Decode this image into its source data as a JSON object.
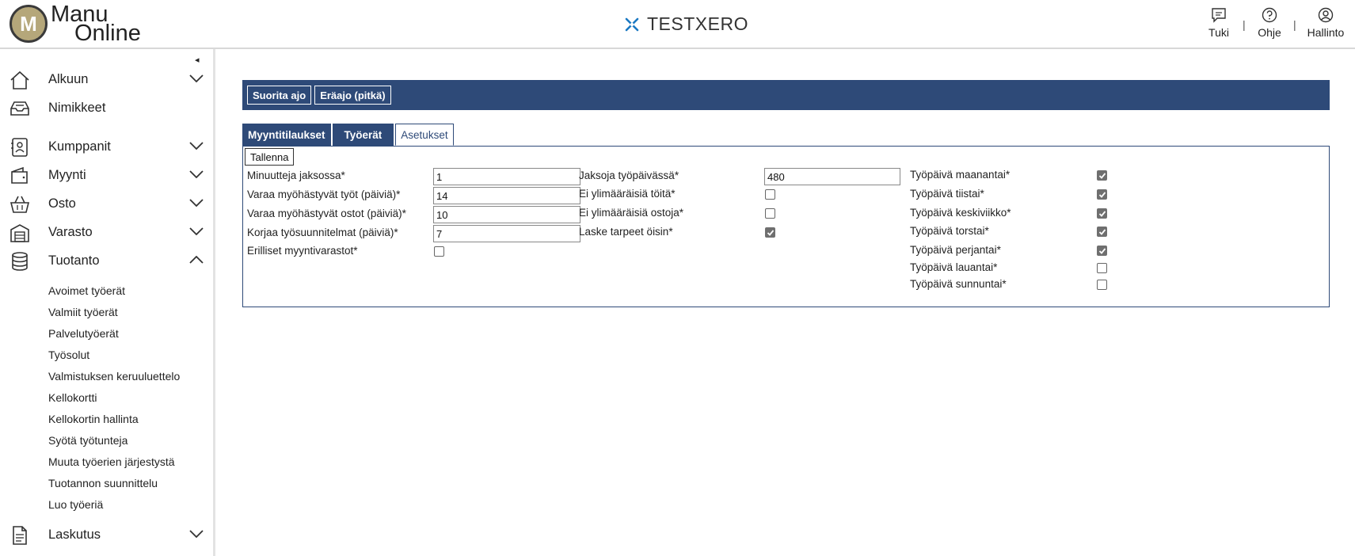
{
  "header": {
    "logo_mark": "M",
    "logo_line1": "Manu",
    "logo_line2": "Online",
    "brand": "TESTXERO",
    "actions": [
      {
        "label": "Tuki",
        "icon": "chat-icon"
      },
      {
        "label": "Ohje",
        "icon": "help-icon"
      },
      {
        "label": "Hallinto",
        "icon": "user-icon"
      }
    ],
    "separator": "|"
  },
  "sidebar": {
    "collapse_icon": "◂",
    "items": [
      {
        "label": "Alkuun",
        "icon": "home-icon",
        "expandable": true,
        "expanded": false
      },
      {
        "label": "Nimikkeet",
        "icon": "inbox-icon",
        "expandable": false
      },
      {
        "label": "Kumppanit",
        "icon": "contacts-icon",
        "expandable": true,
        "expanded": false
      },
      {
        "label": "Myynti",
        "icon": "wallet-icon",
        "expandable": true,
        "expanded": false
      },
      {
        "label": "Osto",
        "icon": "basket-icon",
        "expandable": true,
        "expanded": false
      },
      {
        "label": "Varasto",
        "icon": "warehouse-icon",
        "expandable": true,
        "expanded": false
      },
      {
        "label": "Tuotanto",
        "icon": "database-icon",
        "expandable": true,
        "expanded": true
      },
      {
        "label": "Laskutus",
        "icon": "document-icon",
        "expandable": true,
        "expanded": false
      }
    ],
    "subitems": [
      "Avoimet työerät",
      "Valmiit työerät",
      "Palvelutyöerät",
      "Työsolut",
      "Valmistuksen keruuluettelo",
      "Kellokortti",
      "Kellokortin hallinta",
      "Syötä työtunteja",
      "Muuta työerien järjestystä",
      "Tuotannon suunnittelu",
      "Luo työeriä"
    ]
  },
  "toolbar": {
    "run_label": "Suorita ajo",
    "batch_label": "Eräajo (pitkä)"
  },
  "tabs": [
    {
      "label": "Myyntitilaukset",
      "active": false
    },
    {
      "label": "Työerät",
      "active": false
    },
    {
      "label": "Asetukset",
      "active": true
    }
  ],
  "form": {
    "save_label": "Tallenna",
    "col1": [
      {
        "label": "Minuutteja jaksossa*",
        "type": "text",
        "value": "1"
      },
      {
        "label": "Varaa myöhästyvät työt (päiviä)*",
        "type": "text",
        "value": "14"
      },
      {
        "label": "Varaa myöhästyvät ostot (päiviä)*",
        "type": "text",
        "value": "10"
      },
      {
        "label": "Korjaa työsuunnitelmat (päiviä)*",
        "type": "text",
        "value": "7"
      },
      {
        "label": "Erilliset myyntivarastot*",
        "type": "checkbox",
        "checked": false
      }
    ],
    "col2": [
      {
        "label": "Jaksoja työpäivässä*",
        "type": "text",
        "value": "480"
      },
      {
        "label": "Ei ylimääräisiä töitä*",
        "type": "checkbox",
        "checked": false
      },
      {
        "label": "Ei ylimääräisiä ostoja*",
        "type": "checkbox",
        "checked": false
      },
      {
        "label": "Laske tarpeet öisin*",
        "type": "checkbox",
        "checked": true
      }
    ],
    "col3": [
      {
        "label": "Työpäivä maanantai*",
        "type": "checkbox",
        "checked": true
      },
      {
        "label": "Työpäivä tiistai*",
        "type": "checkbox",
        "checked": true
      },
      {
        "label": "Työpäivä keskiviikko*",
        "type": "checkbox",
        "checked": true
      },
      {
        "label": "Työpäivä torstai*",
        "type": "checkbox",
        "checked": true
      },
      {
        "label": "Työpäivä perjantai*",
        "type": "checkbox",
        "checked": true
      },
      {
        "label": "Työpäivä lauantai*",
        "type": "checkbox",
        "checked": false
      },
      {
        "label": "Työpäivä sunnuntai*",
        "type": "checkbox",
        "checked": false
      }
    ]
  },
  "colors": {
    "accent": "#2e4a78",
    "logo_gold": "#b5a77a",
    "brand_icon": "#1a78c2"
  }
}
